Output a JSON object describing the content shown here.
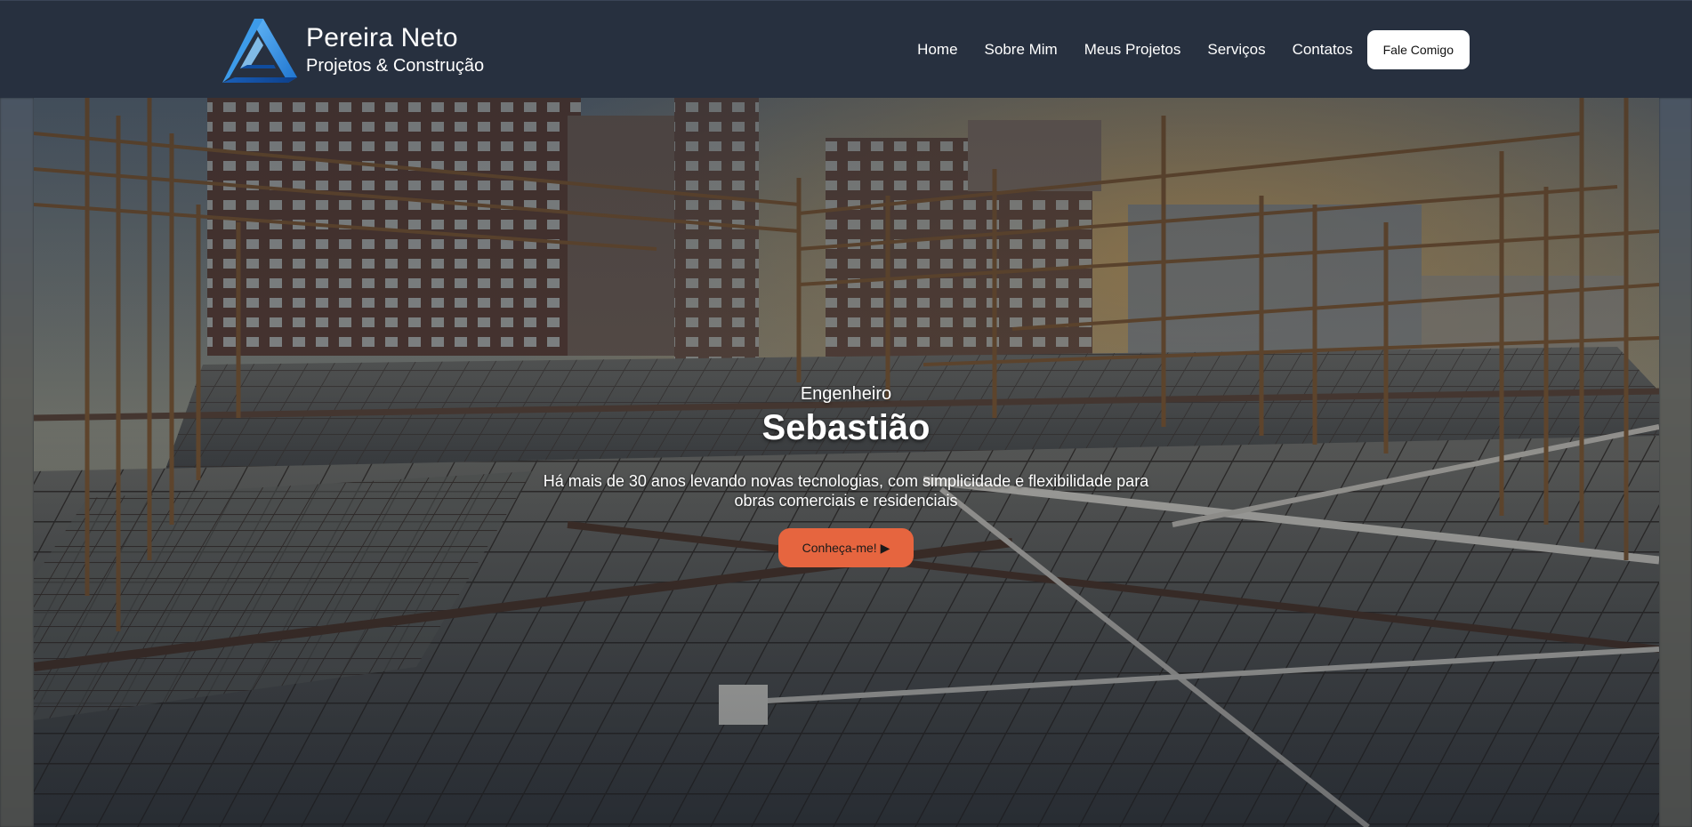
{
  "header": {
    "brand": {
      "name": "Pereira Neto",
      "tagline": "Projetos & Construção",
      "logo_icon": "triangle-logo-icon"
    },
    "nav": [
      {
        "label": "Home"
      },
      {
        "label": "Sobre Mim"
      },
      {
        "label": "Meus Projetos"
      },
      {
        "label": "Serviços"
      },
      {
        "label": "Contatos"
      }
    ],
    "cta_label": "Fale Comigo"
  },
  "hero": {
    "subtitle": "Engenheiro",
    "title": "Sebastião",
    "description": "Há mais de 30 anos levando novas tecnologias, com simplicidade e flexibilidade para obras comerciais e residenciais",
    "button_label": "Conheça-me! ▶",
    "background": "construction-site-rebar-photo"
  },
  "colors": {
    "header_bg": "#27303f",
    "accent": "#e6653f",
    "logo_blue": "#2a8ee0"
  }
}
